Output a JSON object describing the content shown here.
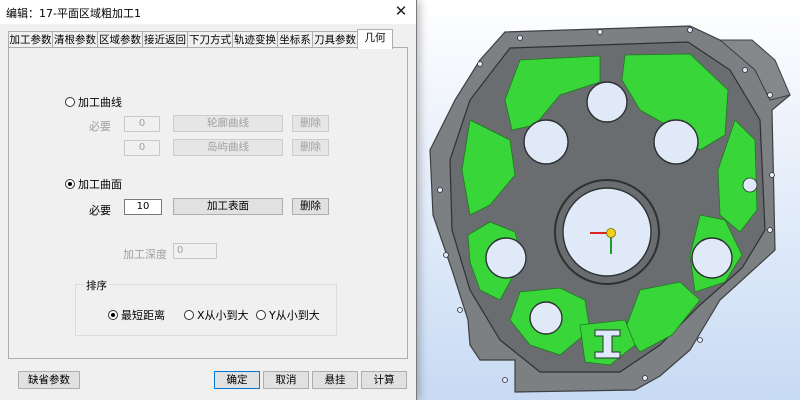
{
  "window": {
    "title": "编辑：17-平面区域粗加工1",
    "close_glyph": "✕"
  },
  "tabs": [
    {
      "label": "加工参数"
    },
    {
      "label": "清根参数"
    },
    {
      "label": "区域参数"
    },
    {
      "label": "接近返回"
    },
    {
      "label": "下刀方式"
    },
    {
      "label": "轨迹变换"
    },
    {
      "label": "坐标系"
    },
    {
      "label": "刀具参数"
    },
    {
      "label": "几何",
      "active": true
    }
  ],
  "curve_section": {
    "radio_label": "加工曲线",
    "selected": false,
    "required_label": "必要",
    "contour_count": "0",
    "contour_button": "轮廓曲线",
    "contour_delete": "删除",
    "island_count": "0",
    "island_button": "岛屿曲线",
    "island_delete": "删除"
  },
  "surface_section": {
    "radio_label": "加工曲面",
    "selected": true,
    "required_label": "必要",
    "surface_count": "10",
    "surface_button": "加工表面",
    "surface_delete": "删除"
  },
  "depth": {
    "label": "加工深度",
    "value": "0"
  },
  "sort": {
    "legend": "排序",
    "options": [
      {
        "label": "最短距离",
        "selected": true
      },
      {
        "label": "X从小到大",
        "selected": false
      },
      {
        "label": "Y从小到大",
        "selected": false
      }
    ]
  },
  "buttons": {
    "defaults": "缺省参数",
    "ok": "确定",
    "cancel": "取消",
    "suspend": "悬挂",
    "calculate": "计算"
  },
  "colors": {
    "toolpath_green": "#39d63a",
    "part_gray": "#6f7275",
    "plate_gray": "#7d8083",
    "focus_blue": "#0078d7"
  }
}
